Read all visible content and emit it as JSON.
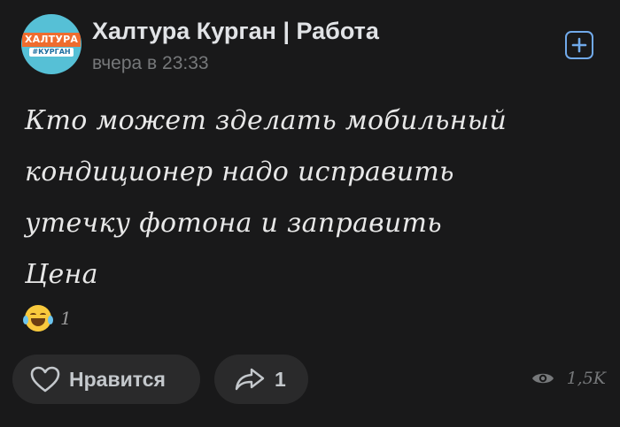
{
  "header": {
    "avatar_line1": "ХАЛТУРА",
    "avatar_line2": "#КУРГАН",
    "group_name": "Халтура Курган | Работа",
    "time": "вчера в 23:33",
    "subscribe_icon": "plus-square-icon",
    "colors": {
      "accent": "#71aaeb",
      "avatar_bg": "#56c0d6",
      "avatar_badge": "#ef6c2e"
    }
  },
  "post": {
    "lines": [
      "Кто может зделать мобильный",
      "кондиционер надо исправить",
      "утечку фотона и заправить",
      "Цена"
    ]
  },
  "reactions": {
    "emoji": "face-with-tears-of-joy-icon",
    "count": "1"
  },
  "footer": {
    "like_label": "Нравится",
    "like_icon": "heart-icon",
    "share_count": "1",
    "share_icon": "share-arrow-icon",
    "views_icon": "eye-icon",
    "views_count": "1,5K"
  }
}
